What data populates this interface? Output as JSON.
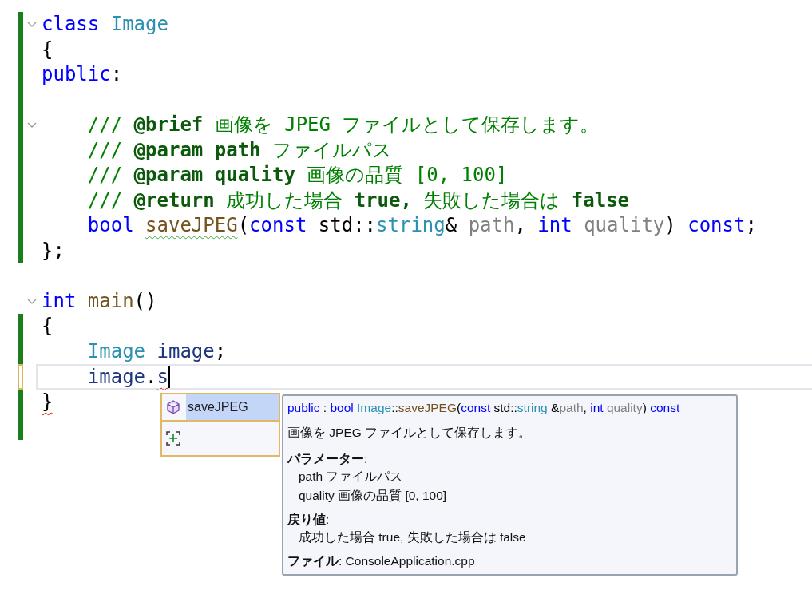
{
  "editor": {
    "lines": [
      {
        "changed": true,
        "saved": true,
        "collapsible": true,
        "tokens": [
          {
            "kind": "keyword",
            "text": "class "
          },
          {
            "kind": "type",
            "text": "Image"
          }
        ]
      },
      {
        "changed": true,
        "saved": true,
        "collapsible": false,
        "tokens": [
          {
            "kind": "plain",
            "text": "{"
          }
        ]
      },
      {
        "changed": true,
        "saved": true,
        "collapsible": false,
        "tokens": [
          {
            "kind": "keyword",
            "text": "public"
          },
          {
            "kind": "plain",
            "text": ":"
          }
        ]
      },
      {
        "changed": true,
        "saved": true,
        "collapsible": false
      },
      {
        "changed": true,
        "saved": true,
        "collapsible": true,
        "tokens": [
          {
            "kind": "comment",
            "text": "    /// "
          },
          {
            "kind": "doctag",
            "text": "@brief"
          },
          {
            "kind": "comment",
            "text": " 画像を JPEG ファイルとして保存します。"
          }
        ]
      },
      {
        "changed": true,
        "saved": true,
        "collapsible": false,
        "tokens": [
          {
            "kind": "comment",
            "text": "    /// "
          },
          {
            "kind": "doctag",
            "text": "@param path"
          },
          {
            "kind": "comment",
            "text": " ファイルパス"
          }
        ]
      },
      {
        "changed": true,
        "saved": true,
        "collapsible": false,
        "tokens": [
          {
            "kind": "comment",
            "text": "    /// "
          },
          {
            "kind": "doctag",
            "text": "@param quality"
          },
          {
            "kind": "comment",
            "text": " 画像の品質 [0, 100]"
          }
        ]
      },
      {
        "changed": true,
        "saved": true,
        "collapsible": false,
        "tokens": [
          {
            "kind": "comment",
            "text": "    /// "
          },
          {
            "kind": "doctag",
            "text": "@return"
          },
          {
            "kind": "comment",
            "text": " 成功した場合 "
          },
          {
            "kind": "doctag",
            "text": "true,"
          },
          {
            "kind": "comment",
            "text": " 失敗した場合は "
          },
          {
            "kind": "doctag",
            "text": "false"
          }
        ]
      },
      {
        "changed": true,
        "saved": true,
        "collapsible": false,
        "tokens": [
          {
            "kind": "keyword",
            "text": "    bool "
          },
          {
            "kind": "function",
            "text": "saveJPEG",
            "warning": true
          },
          {
            "kind": "plain",
            "text": "("
          },
          {
            "kind": "keyword",
            "text": "const "
          },
          {
            "kind": "plain",
            "text": "std::"
          },
          {
            "kind": "type",
            "text": "string"
          },
          {
            "kind": "plain",
            "text": "& "
          },
          {
            "kind": "param",
            "text": "path"
          },
          {
            "kind": "plain",
            "text": ", "
          },
          {
            "kind": "keyword",
            "text": "int "
          },
          {
            "kind": "param",
            "text": "quality"
          },
          {
            "kind": "plain",
            "text": ") "
          },
          {
            "kind": "keyword",
            "text": "const"
          },
          {
            "kind": "plain",
            "text": ";"
          }
        ]
      },
      {
        "changed": true,
        "saved": true,
        "collapsible": false,
        "tokens": [
          {
            "kind": "plain",
            "text": "};"
          }
        ]
      },
      {
        "changed": false,
        "collapsible": false
      },
      {
        "changed": false,
        "collapsible": true,
        "tokens": [
          {
            "kind": "keyword",
            "text": "int "
          },
          {
            "kind": "function",
            "text": "main"
          },
          {
            "kind": "plain",
            "text": "()"
          }
        ]
      },
      {
        "changed": true,
        "saved": true,
        "collapsible": false,
        "tokens": [
          {
            "kind": "plain",
            "text": "{"
          }
        ]
      },
      {
        "changed": true,
        "saved": true,
        "collapsible": false,
        "tokens": [
          {
            "kind": "type",
            "text": "    Image "
          },
          {
            "kind": "variable",
            "text": "image"
          },
          {
            "kind": "plain",
            "text": ";"
          }
        ]
      },
      {
        "changed": true,
        "saved": false,
        "collapsible": false,
        "current": true,
        "tokens": [
          {
            "kind": "variable",
            "text": "    image"
          },
          {
            "kind": "plain",
            "text": "."
          },
          {
            "kind": "variable",
            "text": "s",
            "error": true
          }
        ]
      },
      {
        "changed": true,
        "saved": true,
        "collapsible": false,
        "tokens": [
          {
            "kind": "plain",
            "text": "}",
            "error": true
          }
        ]
      },
      {
        "changed": true,
        "saved": true,
        "collapsible": false
      }
    ]
  },
  "completion": {
    "items": [
      {
        "kind": "method",
        "label": "saveJPEG",
        "selected": true
      },
      {
        "kind": "snippet",
        "selected": false
      }
    ]
  },
  "tooltip": {
    "signature": [
      {
        "kind": "keyword",
        "text": "public"
      },
      {
        "kind": "plain",
        "text": " : "
      },
      {
        "kind": "keyword",
        "text": "bool "
      },
      {
        "kind": "type",
        "text": "Image"
      },
      {
        "kind": "plain",
        "text": "::"
      },
      {
        "kind": "function",
        "text": "saveJPEG"
      },
      {
        "kind": "plain",
        "text": "("
      },
      {
        "kind": "keyword",
        "text": "const "
      },
      {
        "kind": "plain",
        "text": "std::"
      },
      {
        "kind": "type",
        "text": "string"
      },
      {
        "kind": "plain",
        "text": " &"
      },
      {
        "kind": "param",
        "text": "path"
      },
      {
        "kind": "plain",
        "text": ", "
      },
      {
        "kind": "keyword",
        "text": "int "
      },
      {
        "kind": "param",
        "text": "quality"
      },
      {
        "kind": "plain",
        "text": ") "
      },
      {
        "kind": "keyword",
        "text": "const"
      }
    ],
    "summary": "画像を JPEG ファイルとして保存します。",
    "sections": [
      {
        "heading": "**パラメーター**:",
        "lines": [
          "path ファイルパス",
          "quality 画像の品質 [0, 100]"
        ]
      },
      {
        "heading": "**戻り値**:",
        "lines": [
          "成功した場合 true, 失敗した場合は false"
        ]
      }
    ],
    "file": "**ファイル**: ConsoleApplication.cpp"
  }
}
